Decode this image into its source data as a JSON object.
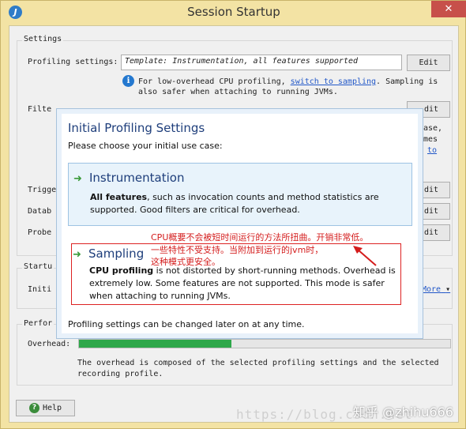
{
  "window": {
    "title": "Session Startup",
    "close_glyph": "✕",
    "app_icon_glyph": "J"
  },
  "settings": {
    "group_label": "Settings",
    "profiling_label": "Profiling settings:",
    "profiling_value": "Template: Instrumentation, all features supported",
    "edit_label": "Edit",
    "info_prefix": "For low-overhead CPU profiling,",
    "info_link": "switch to sampling",
    "info_suffix": ". Sampling is",
    "info_line2": "also safer when attaching to running JVMs.",
    "filter_label": "Filte",
    "trigger_label": "Trigge",
    "databases_label": "Datab",
    "probe_label": "Probe",
    "right_frag_1": "ase,",
    "right_frag_2": "mes",
    "right_frag_link": "to",
    "edit_frag": "dit"
  },
  "startup": {
    "group_label": "Startu",
    "init_label": "Initi",
    "more_label": "More"
  },
  "performance": {
    "group_label": "Perfor",
    "overhead_label": "Overhead:",
    "overhead_level": 0.41,
    "note_line1": "The overhead is composed of the selected profiling settings and the selected",
    "note_line2": "recording profile."
  },
  "help": {
    "label": "Help",
    "glyph": "?"
  },
  "dialog": {
    "title": "Initial Profiling Settings",
    "subtitle": "Please choose your initial use case:",
    "arrow_glyph": "➜",
    "instrumentation": {
      "title": "Instrumentation",
      "desc_bold": "All features",
      "desc_rest": ", such as invocation counts and method statistics are supported. Good filters are critical for overhead."
    },
    "sampling": {
      "title": "Sampling",
      "desc_bold": "CPU profiling",
      "desc_rest": " is not distorted by short-running methods. Overhead is extremely low. Some features are not supported. This mode is safer when attaching to running JVMs."
    },
    "footer": "Profiling settings can be changed later on at any time."
  },
  "annotation": {
    "line1": "CPU概要不会被短时间运行的方法所扭曲。开销非常低。",
    "line2": "一些特性不受支持。当附加到运行的jvm时，",
    "line3": "这种模式更安全。"
  },
  "watermark": {
    "url": "https://blog.csdn.net",
    "brand": "知乎 @zhihu666"
  },
  "colors": {
    "accent": "#1e3e7b",
    "annotation": "#d41c1c",
    "progress": "#2fa84a",
    "highlight_bg": "#e8f3fb"
  }
}
